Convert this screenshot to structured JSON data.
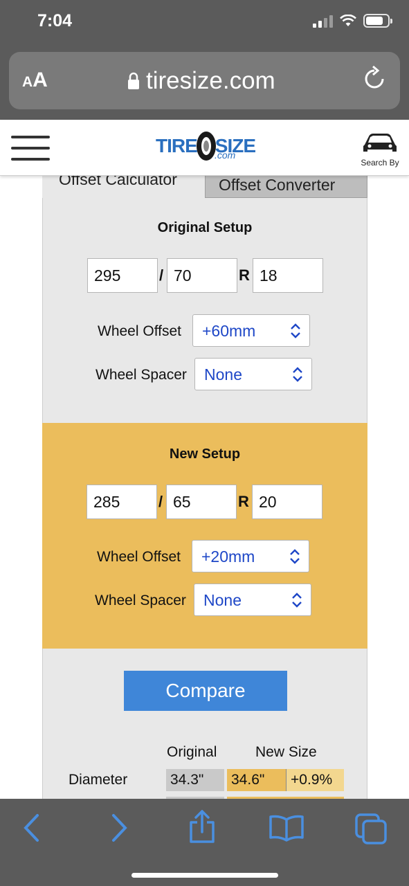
{
  "status": {
    "time": "7:04"
  },
  "browser": {
    "aa_small": "A",
    "aa_big": "A",
    "url": "tiresize.com"
  },
  "site": {
    "logo_part1": "TIRE",
    "logo_part2": "SIZE",
    "logo_domain": ".com",
    "search_by": "Search By"
  },
  "tabs": {
    "active": "Offset Calculator",
    "inactive": "Offset Converter"
  },
  "original": {
    "title": "Original Setup",
    "width": "295",
    "sep1": "/",
    "aspect": "70",
    "sep2": "R",
    "rim": "18",
    "offset_label": "Wheel Offset",
    "offset_value": "+60mm",
    "spacer_label": "Wheel Spacer",
    "spacer_value": "None"
  },
  "new": {
    "title": "New Setup",
    "width": "285",
    "sep1": "/",
    "aspect": "65",
    "sep2": "R",
    "rim": "20",
    "offset_label": "Wheel Offset",
    "offset_value": "+20mm",
    "spacer_label": "Wheel Spacer",
    "spacer_value": "None"
  },
  "results": {
    "compare_label": "Compare",
    "col_original": "Original",
    "col_new": "New Size",
    "rows": [
      {
        "label": "Diameter",
        "original": "34.3\"",
        "new": "34.6\"",
        "diff": "+0.9%"
      }
    ]
  },
  "colors": {
    "accent": "#3f86d8",
    "new_panel": "#ebbd5c",
    "select_text": "#1e47c7"
  }
}
